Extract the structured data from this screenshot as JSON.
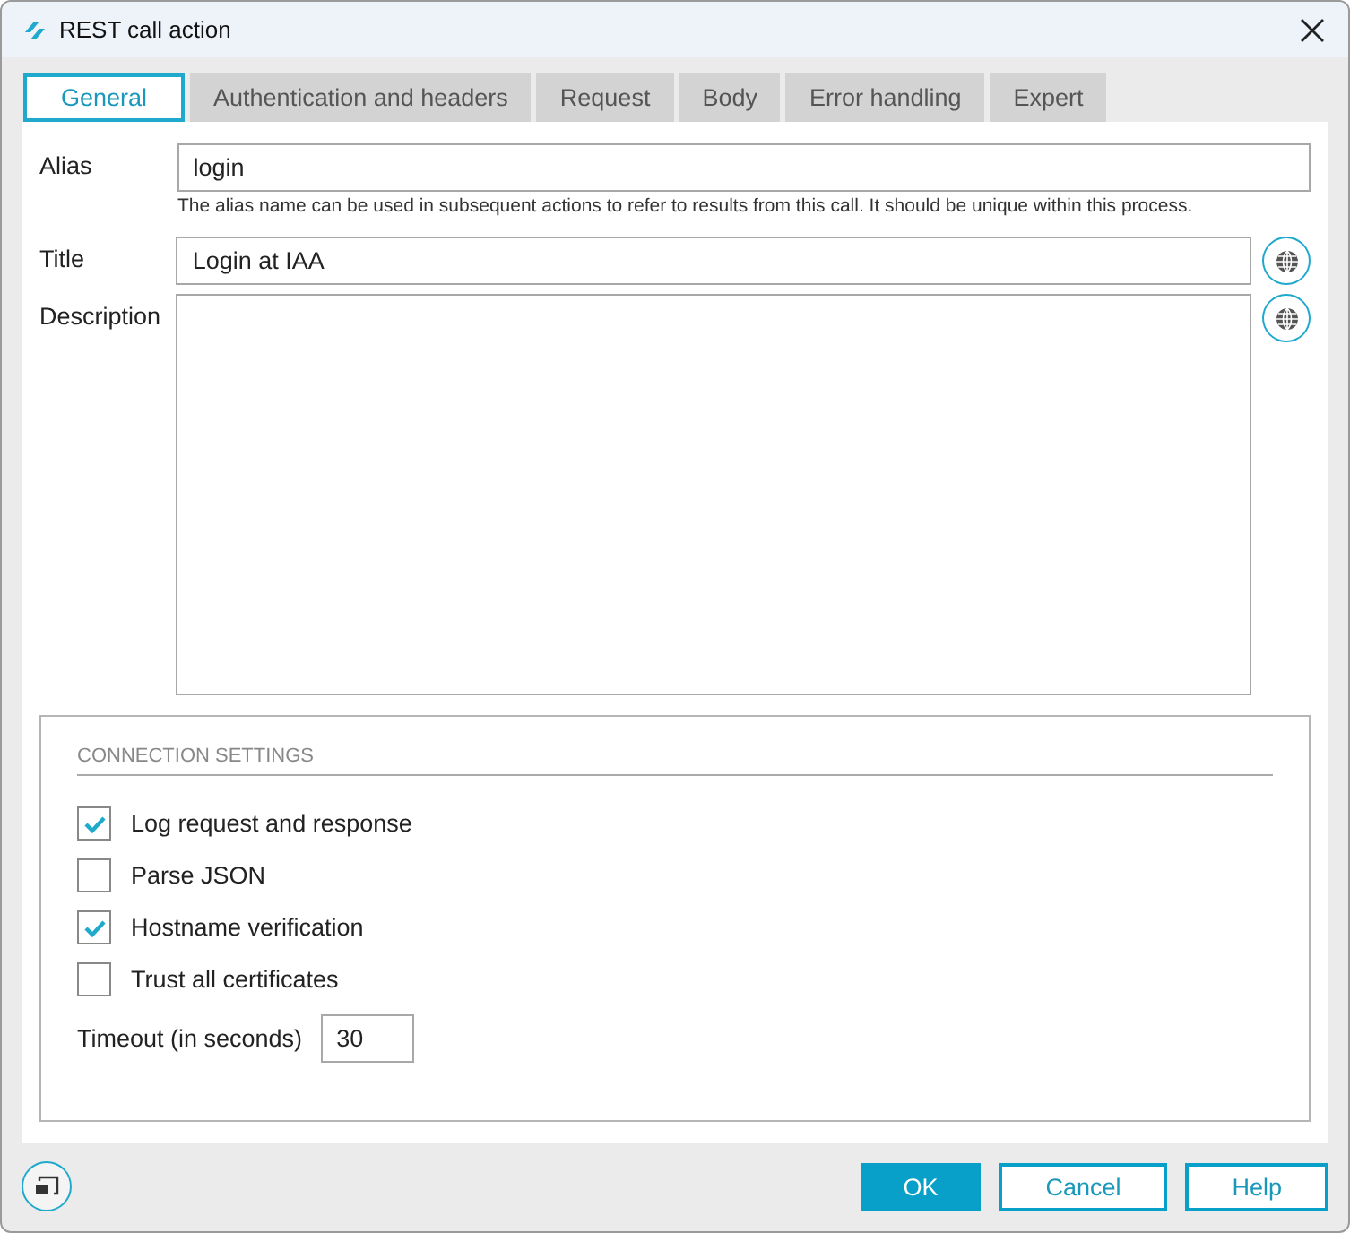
{
  "window": {
    "title": "REST call action"
  },
  "tabs": [
    {
      "label": "General",
      "selected": true
    },
    {
      "label": "Authentication and headers",
      "selected": false
    },
    {
      "label": "Request",
      "selected": false
    },
    {
      "label": "Body",
      "selected": false
    },
    {
      "label": "Error handling",
      "selected": false
    },
    {
      "label": "Expert",
      "selected": false
    }
  ],
  "alias": {
    "label": "Alias",
    "value": "login",
    "hint": "The alias name can be used in subsequent actions to refer to results from this call. It should be unique within this process."
  },
  "title": {
    "label": "Title",
    "value": "Login at IAA"
  },
  "description": {
    "label": "Description"
  },
  "connection_settings": {
    "heading": "CONNECTION SETTINGS",
    "options": [
      {
        "label": "Log request and response",
        "checked": true
      },
      {
        "label": "Parse JSON",
        "checked": false
      },
      {
        "label": "Hostname verification",
        "checked": true
      },
      {
        "label": "Trust all certificates",
        "checked": false
      }
    ],
    "timeout": {
      "label": "Timeout (in seconds)",
      "value": "30"
    }
  },
  "buttons": [
    {
      "label": "OK",
      "kind": "primary"
    },
    {
      "label": "Cancel",
      "kind": "secondary"
    },
    {
      "label": "Help",
      "kind": "secondary"
    }
  ]
}
